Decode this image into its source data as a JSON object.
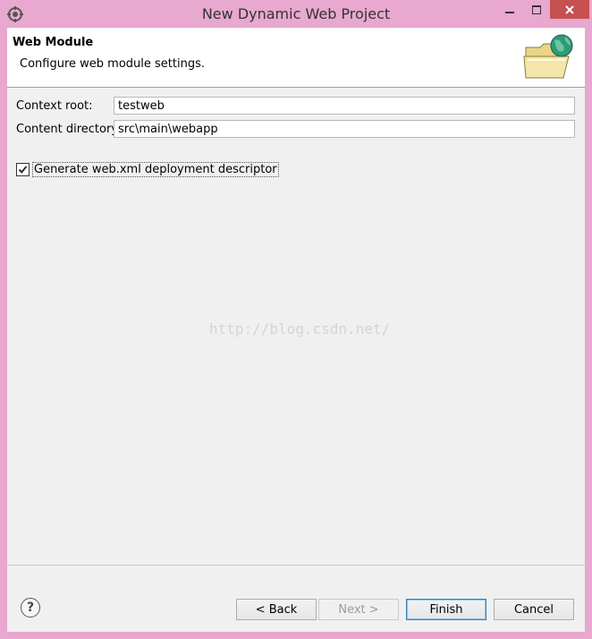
{
  "window": {
    "title": "New Dynamic Web Project",
    "minimize_icon": "minimize-icon",
    "maximize_icon": "maximize-icon",
    "close_icon": "close-icon"
  },
  "header": {
    "title": "Web Module",
    "description": "Configure web module settings.",
    "icon": "web-folder-globe-icon"
  },
  "form": {
    "context_root_label": "Context root:",
    "context_root_value": "testweb",
    "content_directory_label": "Content directory:",
    "content_directory_value": "src\\main\\webapp",
    "generate_webxml_label": "Generate web.xml deployment descriptor",
    "generate_webxml_checked": true
  },
  "watermark": "http://blog.csdn.net/",
  "footer": {
    "help_icon": "help-icon",
    "back_label": "< Back",
    "next_label": "Next >",
    "finish_label": "Finish",
    "cancel_label": "Cancel"
  }
}
